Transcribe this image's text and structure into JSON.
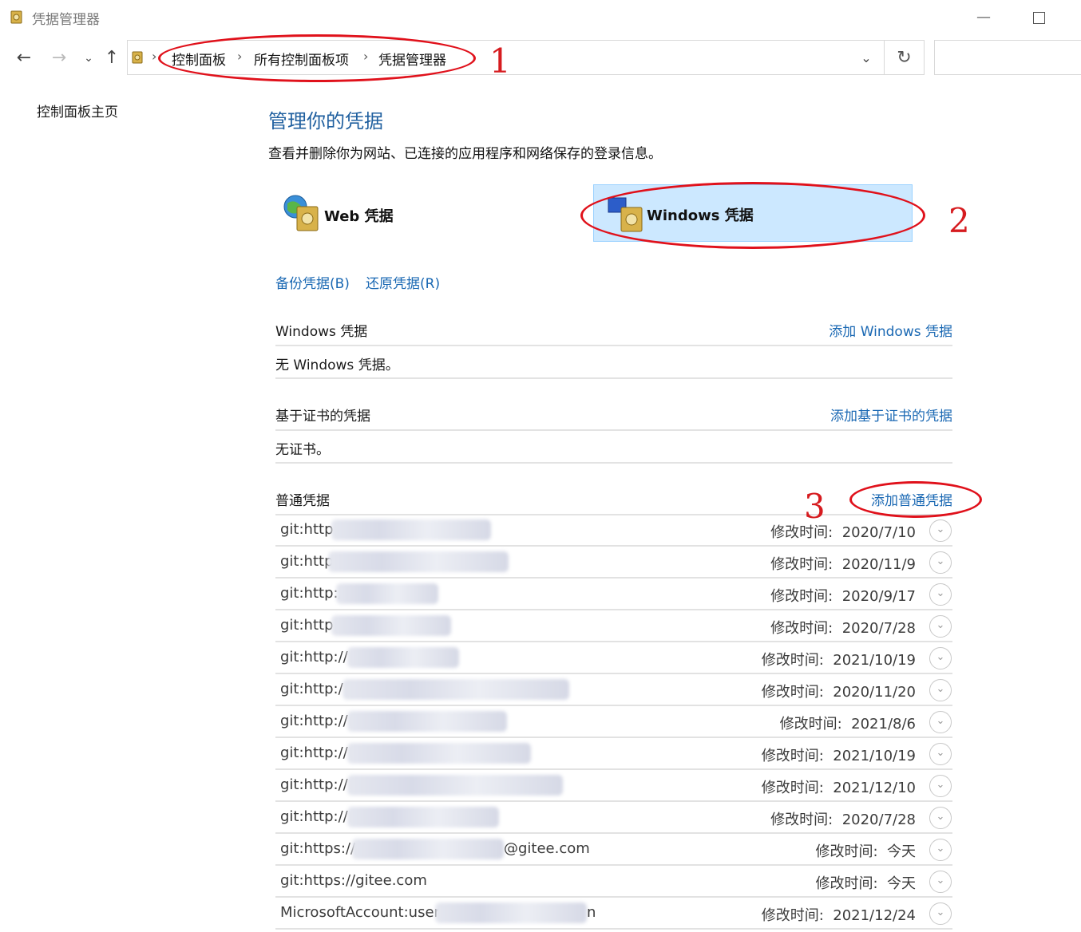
{
  "window": {
    "title": "凭据管理器",
    "minimize": "—"
  },
  "nav": {
    "back": "←",
    "forward": "→",
    "history": "⌄",
    "up": "↑",
    "breadcrumbs": [
      "控制面板",
      "所有控制面板项",
      "凭据管理器"
    ],
    "separator": "›",
    "dropdown": "⌄",
    "refresh": "↻"
  },
  "sidebar": {
    "home": "控制面板主页"
  },
  "main": {
    "title": "管理你的凭据",
    "description": "查看并删除你为网站、已连接的应用程序和网络保存的登录信息。",
    "tiles": {
      "web": "Web 凭据",
      "windows": "Windows 凭据"
    },
    "backup": "备份凭据(B)",
    "restore": "还原凭据(R)",
    "windows_section": {
      "title": "Windows 凭据",
      "add": "添加 Windows 凭据",
      "empty": "无 Windows 凭据。"
    },
    "cert_section": {
      "title": "基于证书的凭据",
      "add": "添加基于证书的凭据",
      "empty": "无证书。"
    },
    "generic_section": {
      "title": "普通凭据",
      "add": "添加普通凭据",
      "modified_label": "修改时间:",
      "items": [
        {
          "name": "git:http",
          "modified": "2020/7/10"
        },
        {
          "name": "git:http",
          "modified": "2020/11/9"
        },
        {
          "name": "git:http:/",
          "modified": "2020/9/17"
        },
        {
          "name": "git:http:",
          "modified": "2020/7/28"
        },
        {
          "name": "git:http://",
          "modified": "2021/10/19"
        },
        {
          "name": "git:http:/",
          "modified": "2020/11/20"
        },
        {
          "name": "git:http://",
          "modified": "2021/8/6"
        },
        {
          "name": "git:http://",
          "modified": "2021/10/19"
        },
        {
          "name": "git:http://",
          "modified": "2021/12/10"
        },
        {
          "name": "git:http://",
          "modified": "2020/7/28"
        },
        {
          "name": "git:https://",
          "suffix": "@gitee.com",
          "modified": "今天"
        },
        {
          "name": "git:https://gitee.com",
          "modified": "今天"
        },
        {
          "name": "MicrosoftAccount:user",
          "suffix": "n",
          "modified": "2021/12/24"
        }
      ]
    }
  },
  "annotations": [
    "1",
    "2",
    "3"
  ],
  "colors": {
    "accent": "#1a68b3",
    "annotation": "#e0111b",
    "tile_selected": "#cce8ff"
  }
}
